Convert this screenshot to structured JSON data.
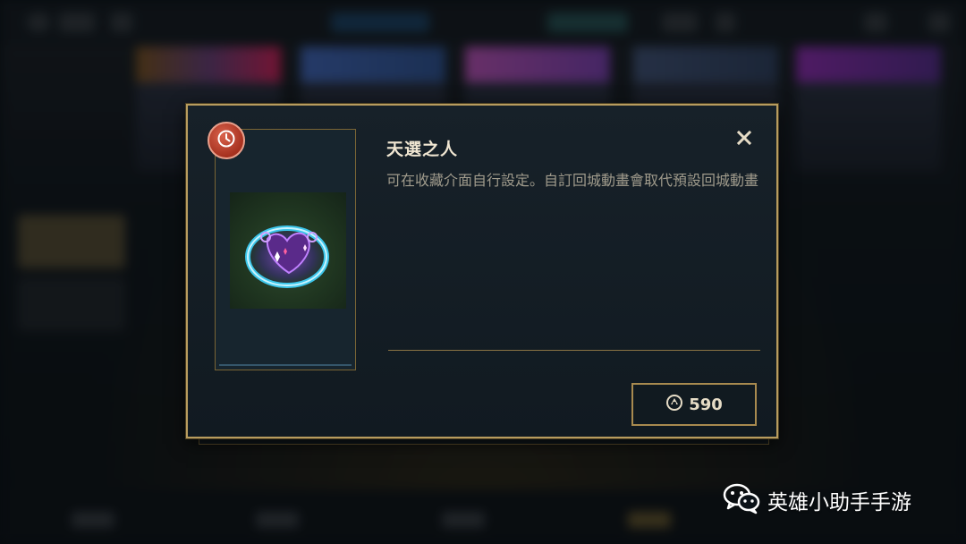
{
  "dialog": {
    "title": "天選之人",
    "description": "可在收藏介面自行設定。自訂回城動畫會取代預設回城動畫",
    "price": "590",
    "currency_icon": "rp-coin-icon",
    "badge_icon": "clock-icon",
    "close_icon": "close-icon"
  },
  "watermark": {
    "text": "英雄小助手手游",
    "icon": "wechat-icon"
  },
  "colors": {
    "gold": "#b89c5e",
    "title": "#f0e6d2",
    "body_text": "#a09b8c",
    "badge_red": "#b8402b",
    "glow_cyan": "#3fd6ff"
  }
}
